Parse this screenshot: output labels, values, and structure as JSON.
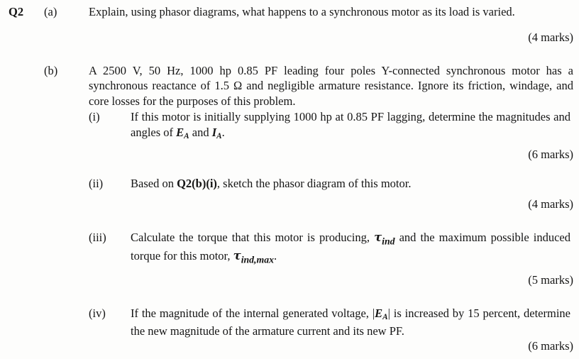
{
  "document": {
    "question_number": "Q2",
    "background_color": "#fdfdfc",
    "text_color": "#151515"
  },
  "parts": {
    "a": {
      "label": "(a)",
      "text": "Explain, using phasor diagrams, what happens to a synchronous motor as its load is varied.",
      "marks": "(4 marks)"
    },
    "b": {
      "label": "(b)",
      "stem": "A 2500 V, 50 Hz, 1000 hp 0.85 PF leading four poles Y-connected synchronous motor has a synchronous reactance of 1.5 Ω and negligible armature resistance. Ignore its friction, windage, and core losses for the purposes of this problem.",
      "subparts": [
        {
          "label": "(i)",
          "text_before": "If this motor is initially supplying 1000 hp at 0.85 PF lagging, determine the magnitudes and angles of ",
          "symbol_1_base": "E",
          "symbol_1_sub": "A",
          "text_mid": " and ",
          "symbol_2_base": "I",
          "symbol_2_sub": "A",
          "text_after": ".",
          "marks": "(6 marks)"
        },
        {
          "label": "(ii)",
          "text_before": "Based on ",
          "reference": "Q2(b)(i)",
          "text_after": ", sketch the phasor diagram of this motor.",
          "marks": "(4 marks)"
        },
        {
          "label": "(iii)",
          "text_before": "Calculate the torque that this motor is producing, ",
          "symbol_1_base": "τ",
          "symbol_1_sub": "ind",
          "text_mid": " and the maximum possible induced torque for this motor, ",
          "symbol_2_base": "τ",
          "symbol_2_sub": "ind,max",
          "text_after": ".",
          "marks": "(5 marks)"
        },
        {
          "label": "(iv)",
          "text_before": "If the magnitude of the internal generated voltage, |",
          "symbol_1_base": "E",
          "symbol_1_sub": "A",
          "text_after": "| is increased by 15 percent, determine the new magnitude of the armature current and its new PF.",
          "marks": "(6 marks)"
        }
      ]
    }
  }
}
